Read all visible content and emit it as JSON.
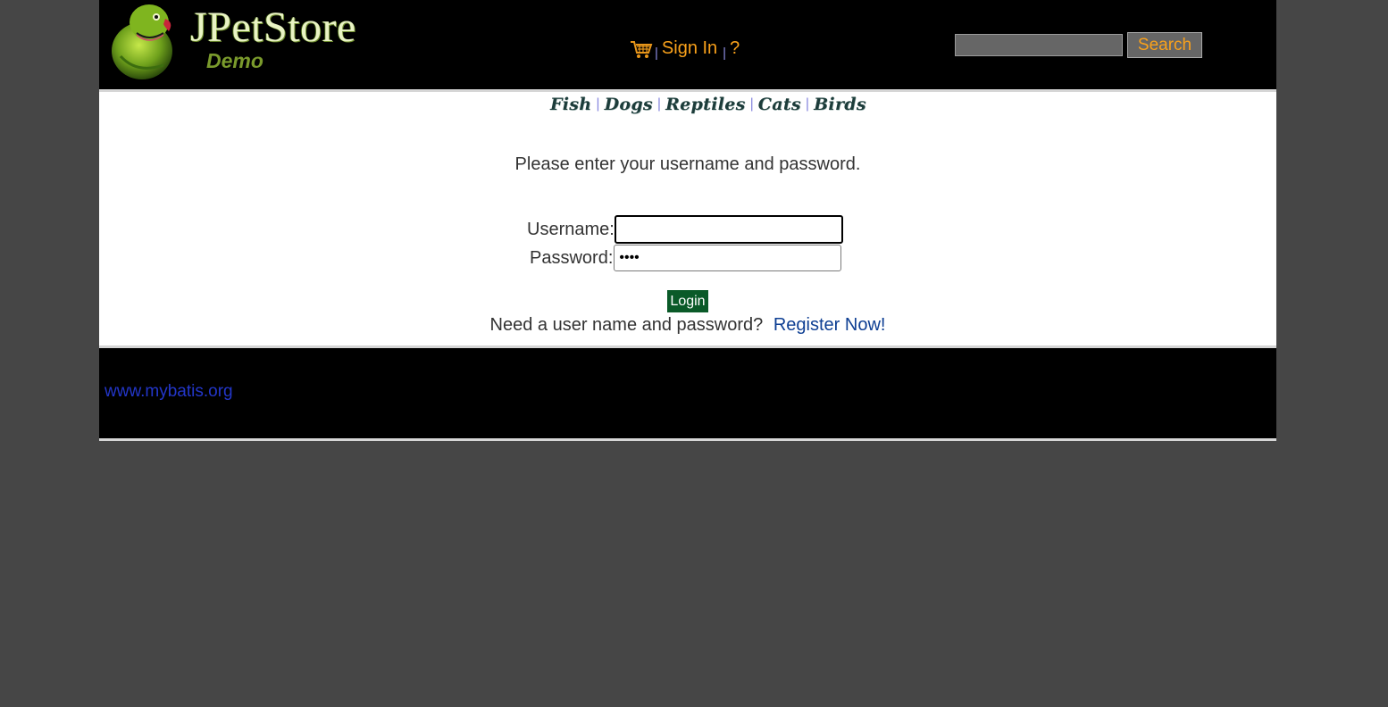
{
  "header": {
    "logo_title": "JPetStore",
    "logo_subtitle": "Demo",
    "menu": {
      "separator": "|",
      "sign_in_label": "Sign In",
      "help_label": "?"
    },
    "search": {
      "value": "",
      "placeholder": "",
      "button_label": "Search"
    }
  },
  "quicklinks": {
    "separator": "|",
    "items": [
      "Fish",
      "Dogs",
      "Reptiles",
      "Cats",
      "Birds"
    ]
  },
  "login_form": {
    "prompt": "Please enter your username and password.",
    "username_label": "Username:",
    "username_value": "",
    "password_label": "Password:",
    "password_value": "••••",
    "login_button_label": "Login",
    "register_prompt": "Need a user name and password?",
    "register_link_label": "Register Now!"
  },
  "footer": {
    "link_label": "www.mybatis.org"
  },
  "colors": {
    "page_background": "#464646",
    "bar_background": "#000000",
    "accent_orange": "#f9a11b",
    "login_button": "#0a5a28",
    "link_blue": "#0e3f93"
  }
}
